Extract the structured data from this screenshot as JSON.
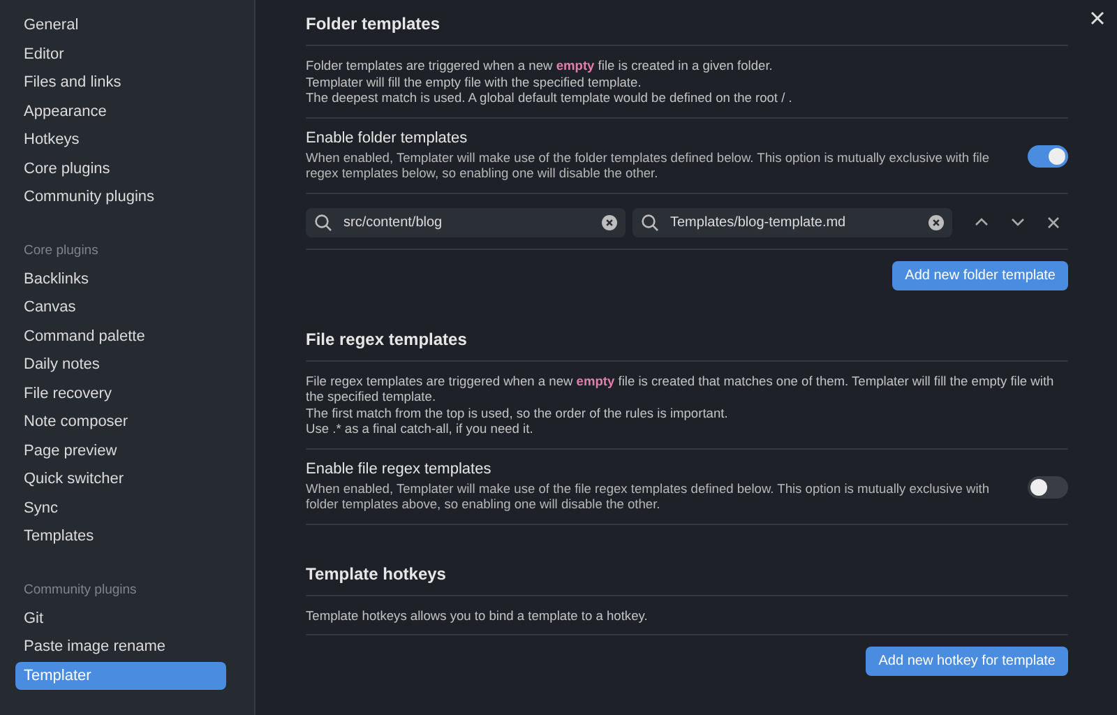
{
  "sidebar": {
    "groups": [
      {
        "items": [
          {
            "label": "General",
            "selected": false
          },
          {
            "label": "Editor",
            "selected": false
          },
          {
            "label": "Files and links",
            "selected": false
          },
          {
            "label": "Appearance",
            "selected": false
          },
          {
            "label": "Hotkeys",
            "selected": false
          },
          {
            "label": "Core plugins",
            "selected": false
          },
          {
            "label": "Community plugins",
            "selected": false
          }
        ]
      },
      {
        "heading": "Core plugins",
        "items": [
          {
            "label": "Backlinks",
            "selected": false
          },
          {
            "label": "Canvas",
            "selected": false
          },
          {
            "label": "Command palette",
            "selected": false
          },
          {
            "label": "Daily notes",
            "selected": false
          },
          {
            "label": "File recovery",
            "selected": false
          },
          {
            "label": "Note composer",
            "selected": false
          },
          {
            "label": "Page preview",
            "selected": false
          },
          {
            "label": "Quick switcher",
            "selected": false
          },
          {
            "label": "Sync",
            "selected": false
          },
          {
            "label": "Templates",
            "selected": false
          }
        ]
      },
      {
        "heading": "Community plugins",
        "items": [
          {
            "label": "Git",
            "selected": false
          },
          {
            "label": "Paste image rename",
            "selected": false
          },
          {
            "label": "Templater",
            "selected": true
          }
        ]
      }
    ]
  },
  "sections": [
    {
      "heading": "Folder templates",
      "description": [
        "Folder templates are triggered when a new **empty** file is created in a given folder.",
        "Templater will fill the empty file with the specified template.",
        "The deepest match is used. A global default template would be defined on the root  / ."
      ],
      "setting": {
        "name": "Enable folder templates",
        "description": "When enabled, Templater will make use of the folder templates defined below. This option is mutually exclusive with file regex templates below, so enabling one will disable the other.",
        "on": true
      },
      "rows": [
        {
          "folder": "src/content/blog",
          "template": "Templates/blog-template.md"
        }
      ],
      "button": "Add new folder template"
    },
    {
      "heading": "File regex templates",
      "description": [
        "File regex templates are triggered when a new **empty** file is created that matches one of them. Templater will fill the empty file with the specified template.",
        "The first match from the top is used, so the order of the rules is important.",
        "Use  .*  as a final catch-all, if you need it."
      ],
      "setting": {
        "name": "Enable file regex templates",
        "description": "When enabled, Templater will make use of the file regex templates defined below. This option is mutually exclusive with folder templates above, so enabling one will disable the other.",
        "on": false
      }
    },
    {
      "heading": "Template hotkeys",
      "description": [
        "Template hotkeys allows you to bind a template to a hotkey."
      ],
      "button": "Add new hotkey for template"
    }
  ]
}
